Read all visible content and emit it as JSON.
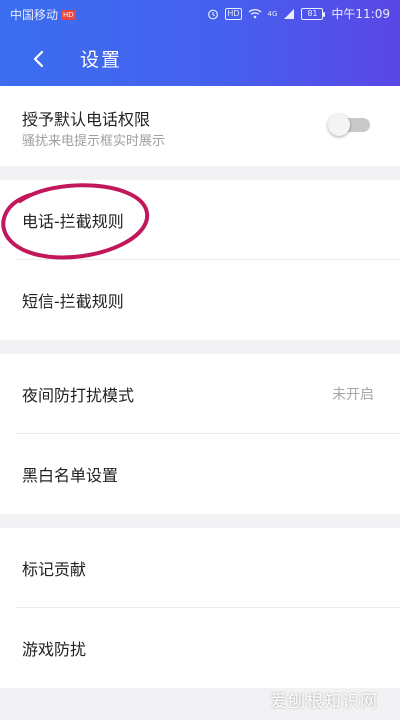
{
  "status_bar": {
    "carrier": "中国移动",
    "carrier_badge": "HD",
    "hd_icon": "HD",
    "signal_label": "4G",
    "battery": "81",
    "time": "中午11:09"
  },
  "header": {
    "title": "设置",
    "back_icon": "chevron-left-icon"
  },
  "sections": [
    {
      "rows": [
        {
          "title": "授予默认电话权限",
          "subtitle": "骚扰来电提示框实时展示",
          "toggle_on": false
        }
      ]
    },
    {
      "rows": [
        {
          "label": "电话-拦截规则"
        },
        {
          "label": "短信-拦截规则"
        }
      ]
    },
    {
      "rows": [
        {
          "label": "夜间防打扰模式",
          "value": "未开启"
        },
        {
          "label": "黑白名单设置"
        }
      ]
    },
    {
      "rows": [
        {
          "label": "标记贡献"
        },
        {
          "label": "游戏防扰"
        }
      ]
    }
  ],
  "watermark": "爱刨根知识网",
  "colors": {
    "header_start": "#3b6ef0",
    "header_end": "#5a47e6",
    "annotation": "#c2185b",
    "page_bg": "#f2f2f4"
  }
}
